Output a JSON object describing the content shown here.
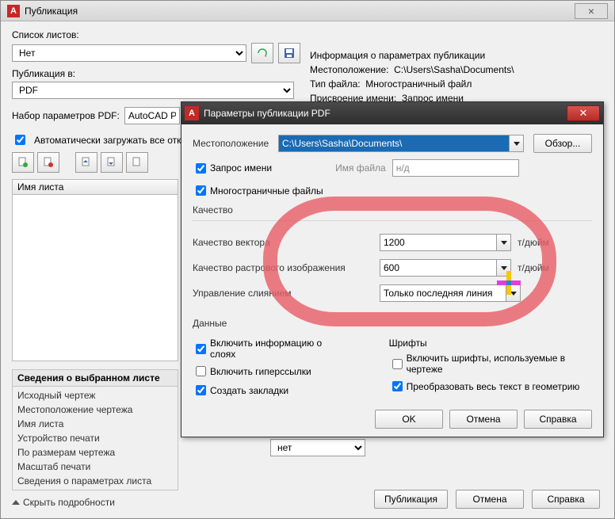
{
  "pub": {
    "title": "Публикация",
    "close_btn": "×",
    "list_label": "Список листов:",
    "list_value": "Нет",
    "publish_to_label": "Публикация в:",
    "publish_to_value": "PDF",
    "pdf_preset_label": "Набор параметров PDF:",
    "pdf_preset_value": "AutoCAD PD",
    "auto_load_label": "Автоматически загружать все отк",
    "sheet_name_header": "Имя листа",
    "info_header": "Информация о параметрах публикации",
    "info_loc_label": "Местоположение:",
    "info_loc_value": "C:\\Users\\Sasha\\Documents\\",
    "info_type_label": "Тип файла:",
    "info_type_value": "Многостраничный файл",
    "info_name_label": "Присвоение имени:",
    "info_name_value": "Запрос имени",
    "group_title": "Сведения о выбранном листе",
    "group_items": [
      "Исходный чертеж",
      "Местоположение чертежа",
      "Имя листа",
      "Устройство печати",
      "По размерам чертежа",
      "Масштаб печати",
      "Сведения о параметрах листа"
    ],
    "hide_details": "Скрыть подробности",
    "precision_value": "нет",
    "footer": {
      "publish": "Публикация",
      "cancel": "Отмена",
      "help": "Справка"
    }
  },
  "pdf": {
    "title": "Параметры публикации PDF",
    "loc_label": "Местоположение",
    "loc_value": "C:\\Users\\Sasha\\Documents\\",
    "browse": "Обзор...",
    "prompt_name": "Запрос имени",
    "filename_lbl": "Имя файла",
    "filename_val": "н/д",
    "multipage": "Многостраничные файлы",
    "quality_section": "Качество",
    "vector_q": "Качество вектора",
    "vector_q_val": "1200",
    "raster_q": "Качество растрового изображения",
    "raster_q_val": "600",
    "unit": "т/дюйм",
    "merge_ctrl": "Управление слиянием",
    "merge_val": "Только последняя линия",
    "data_section": "Данные",
    "inc_layers": "Включить информацию о слоях",
    "inc_links": "Включить гиперссылки",
    "inc_bookmarks": "Создать закладки",
    "fonts_section": "Шрифты",
    "inc_fonts": "Включить шрифты, используемые в чертеже",
    "text_to_geom": "Преобразовать весь текст в геометрию",
    "ok": "OK",
    "cancel": "Отмена",
    "help": "Справка"
  }
}
